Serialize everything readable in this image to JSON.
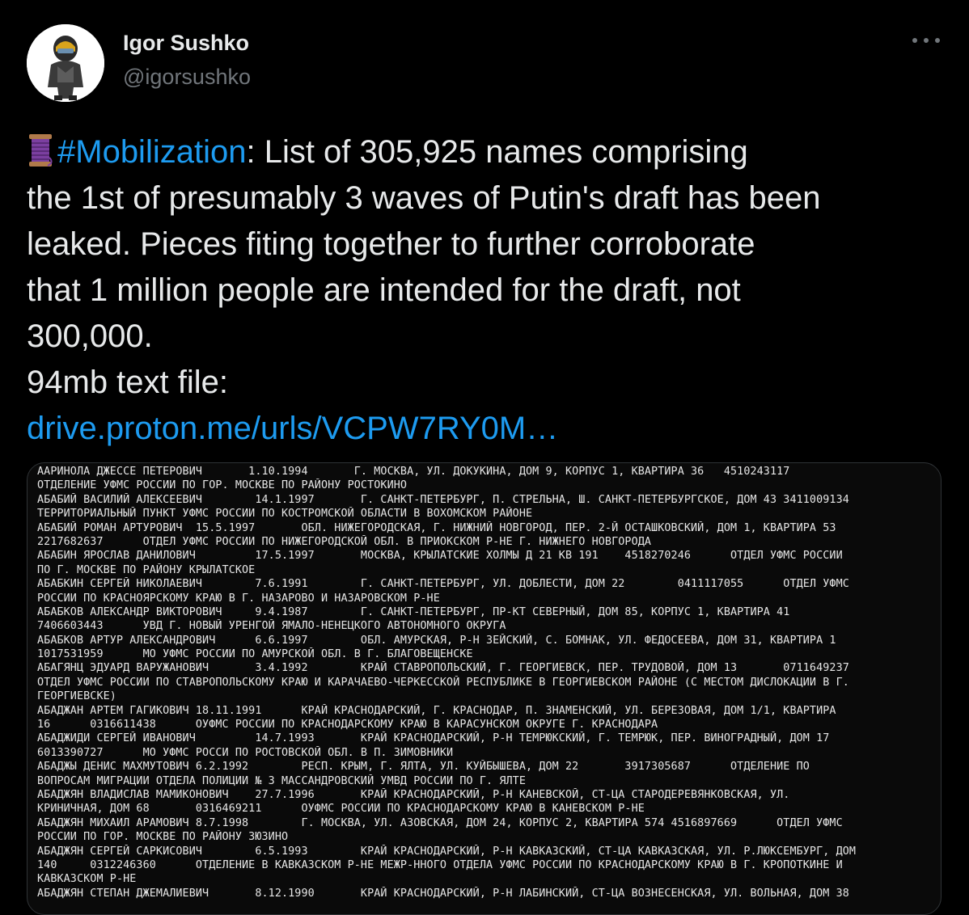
{
  "author": {
    "name": "Igor Sushko",
    "handle": "@igorsushko"
  },
  "icons": {
    "avatar": "avatar-racer-icon",
    "more": "more-dots-icon",
    "spool": "spool-of-thread-icon"
  },
  "colors": {
    "background": "#000000",
    "text": "#e7e9ea",
    "link": "#1d9bf0",
    "muted": "#71767b"
  },
  "tweet": {
    "hashtag": "#Mobilization",
    "text_after_hashtag": ": List of 305,925 names comprising",
    "lines": [
      "the 1st of presumably 3 waves of Putin's draft has been",
      "leaked. Pieces fiting together to further corroborate",
      "that 1 million people are intended for the draft, not",
      "300,000.",
      "94mb text file:"
    ],
    "link": "drive.proton.me/urls/VCPW7RY0M…"
  },
  "document_lines": [
    "ААРИНОЛА ДЖЕССЕ ПЕТЕРОВИЧ       1.10.1994       Г. МОСКВА, УЛ. ДОКУКИНА, ДОМ 9, КОРПУС 1, КВАРТИРА 36   4510243117",
    "ОТДЕЛЕНИЕ УФМС РОССИИ ПО ГОР. МОСКВЕ ПО РАЙОНУ РОСТОКИНО",
    "АБАБИЙ ВАСИЛИЙ АЛЕКСЕЕВИЧ        14.1.1997       Г. САНКТ-ПЕТЕРБУРГ, П. СТРЕЛЬНА, Ш. САНКТ-ПЕТЕРБУРГСКОЕ, ДОМ 43 3411009134",
    "ТЕРРИТОРИАЛЬНЫЙ ПУНКТ УФМС РОССИИ ПО КОСТРОМСКОЙ ОБЛАСТИ В ВОХОМСКОМ РАЙОНЕ",
    "АБАБИЙ РОМАН АРТУРОВИЧ  15.5.1997       ОБЛ. НИЖЕГОРОДСКАЯ, Г. НИЖНИЙ НОВГОРОД, ПЕР. 2-Й ОСТАШКОВСКИЙ, ДОМ 1, КВАРТИРА 53",
    "2217682637      ОТДЕЛ УФМС РОССИИ ПО НИЖЕГОРОДСКОЙ ОБЛ. В ПРИОКСКОМ Р-НЕ Г. НИЖНЕГО НОВГОРОДА",
    "АБАБИН ЯРОСЛАВ ДАНИЛОВИЧ         17.5.1997       МОСКВА, КРЫЛАТСКИЕ ХОЛМЫ Д 21 КВ 191    4518270246      ОТДЕЛ УФМС РОССИИ",
    "ПО Г. МОСКВЕ ПО РАЙОНУ КРЫЛАТСКОЕ",
    "АБАБКИН СЕРГЕЙ НИКОЛАЕВИЧ        7.6.1991        Г. САНКТ-ПЕТЕРБУРГ, УЛ. ДОБЛЕСТИ, ДОМ 22        0411117055      ОТДЕЛ УФМС",
    "РОССИИ ПО КРАСНОЯРСКОМУ КРАЮ В Г. НАЗАРОВО И НАЗАРОВСКОМ Р-НЕ",
    "АБАБКОВ АЛЕКСАНДР ВИКТОРОВИЧ     9.4.1987        Г. САНКТ-ПЕТЕРБУРГ, ПР-КТ СЕВЕРНЫЙ, ДОМ 85, КОРПУС 1, КВАРТИРА 41",
    "7406603443      УВД Г. НОВЫЙ УРЕНГОЙ ЯМАЛО-НЕНЕЦКОГО АВТОНОМНОГО ОКРУГА",
    "АБАБКОВ АРТУР АЛЕКСАНДРОВИЧ      6.6.1997        ОБЛ. АМУРСКАЯ, Р-Н ЗЕЙСКИЙ, С. БОМНАК, УЛ. ФЕДОСЕЕВА, ДОМ 31, КВАРТИРА 1",
    "1017531959      МО УФМС РОССИИ ПО АМУРСКОЙ ОБЛ. В Г. БЛАГОВЕЩЕНСКЕ",
    "АБАГЯНЦ ЭДУАРД ВАРУЖАНОВИЧ       3.4.1992        КРАЙ СТАВРОПОЛЬСКИЙ, Г. ГЕОРГИЕВСК, ПЕР. ТРУДОВОЙ, ДОМ 13       0711649237",
    "ОТДЕЛ УФМС РОССИИ ПО СТАВРОПОЛЬСКОМУ КРАЮ И КАРАЧАЕВО-ЧЕРКЕССКОЙ РЕСПУБЛИКЕ В ГЕОРГИЕВСКОМ РАЙОНЕ (С МЕСТОМ ДИСЛОКАЦИИ В Г.",
    "ГЕОРГИЕВСКЕ)",
    "АБАДЖАН АРТЕМ ГАГИКОВИЧ 18.11.1991      КРАЙ КРАСНОДАРСКИЙ, Г. КРАСНОДАР, П. ЗНАМЕНСКИЙ, УЛ. БЕРЕЗОВАЯ, ДОМ 1/1, КВАРТИРА",
    "16      0316611438      ОУФМС РОССИИ ПО КРАСНОДАРСКОМУ КРАЮ В КАРАСУНСКОМ ОКРУГЕ Г. КРАСНОДАРА",
    "АБАДЖИДИ СЕРГЕЙ ИВАНОВИЧ         14.7.1993       КРАЙ КРАСНОДАРСКИЙ, Р-Н ТЕМРЮКСКИЙ, Г. ТЕМРЮК, ПЕР. ВИНОГРАДНЫЙ, ДОМ 17",
    "6013390727      МО УФМС РОССИ ПО РОСТОВСКОЙ ОБЛ. В П. ЗИМОВНИКИ",
    "АБАДЖЫ ДЕНИС МАХМУТОВИЧ 6.2.1992        РЕСП. КРЫМ, Г. ЯЛТА, УЛ. КУЙБЫШЕВА, ДОМ 22       3917305687      ОТДЕЛЕНИЕ ПО",
    "ВОПРОСАМ МИГРАЦИИ ОТДЕЛА ПОЛИЦИИ № 3 МАССАНДРОВСКИЙ УМВД РОССИИ ПО Г. ЯЛТЕ",
    "АБАДЖЯН ВЛАДИСЛАВ МАМИКОНОВИЧ    27.7.1996       КРАЙ КРАСНОДАРСКИЙ, Р-Н КАНЕВСКОЙ, СТ-ЦА СТАРОДЕРЕВЯНКОВСКАЯ, УЛ.",
    "КРИНИЧНАЯ, ДОМ 68       0316469211      ОУФМС РОССИИ ПО КРАСНОДАРСКОМУ КРАЮ В КАНЕВСКОМ Р-НЕ",
    "АБАДЖЯН МИХАИЛ АРАМОВИЧ 8.7.1998        Г. МОСКВА, УЛ. АЗОВСКАЯ, ДОМ 24, КОРПУС 2, КВАРТИРА 574 4516897669      ОТДЕЛ УФМС",
    "РОССИИ ПО ГОР. МОСКВЕ ПО РАЙОНУ ЗЮЗИНО",
    "АБАДЖЯН СЕРГЕЙ САРКИСОВИЧ        6.5.1993        КРАЙ КРАСНОДАРСКИЙ, Р-Н КАВКАЗСКИЙ, СТ-ЦА КАВКАЗСКАЯ, УЛ. Р.ЛЮКСЕМБУРГ, ДОМ",
    "140     0312246360      ОТДЕЛЕНИЕ В КАВКАЗСКОМ Р-НЕ МЕЖР-ННОГО ОТДЕЛА УФМС РОССИИ ПО КРАСНОДАРСКОМУ КРАЮ В Г. КРОПОТКИНЕ И",
    "КАВКАЗСКОМ Р-НЕ",
    "АБАДЖЯН СТЕПАН ДЖЕМАЛИЕВИЧ       8.12.1990       КРАЙ КРАСНОДАРСКИЙ, Р-Н ЛАБИНСКИЙ, СТ-ЦА ВОЗНЕСЕНСКАЯ, УЛ. ВОЛЬНАЯ, ДОМ 38"
  ]
}
